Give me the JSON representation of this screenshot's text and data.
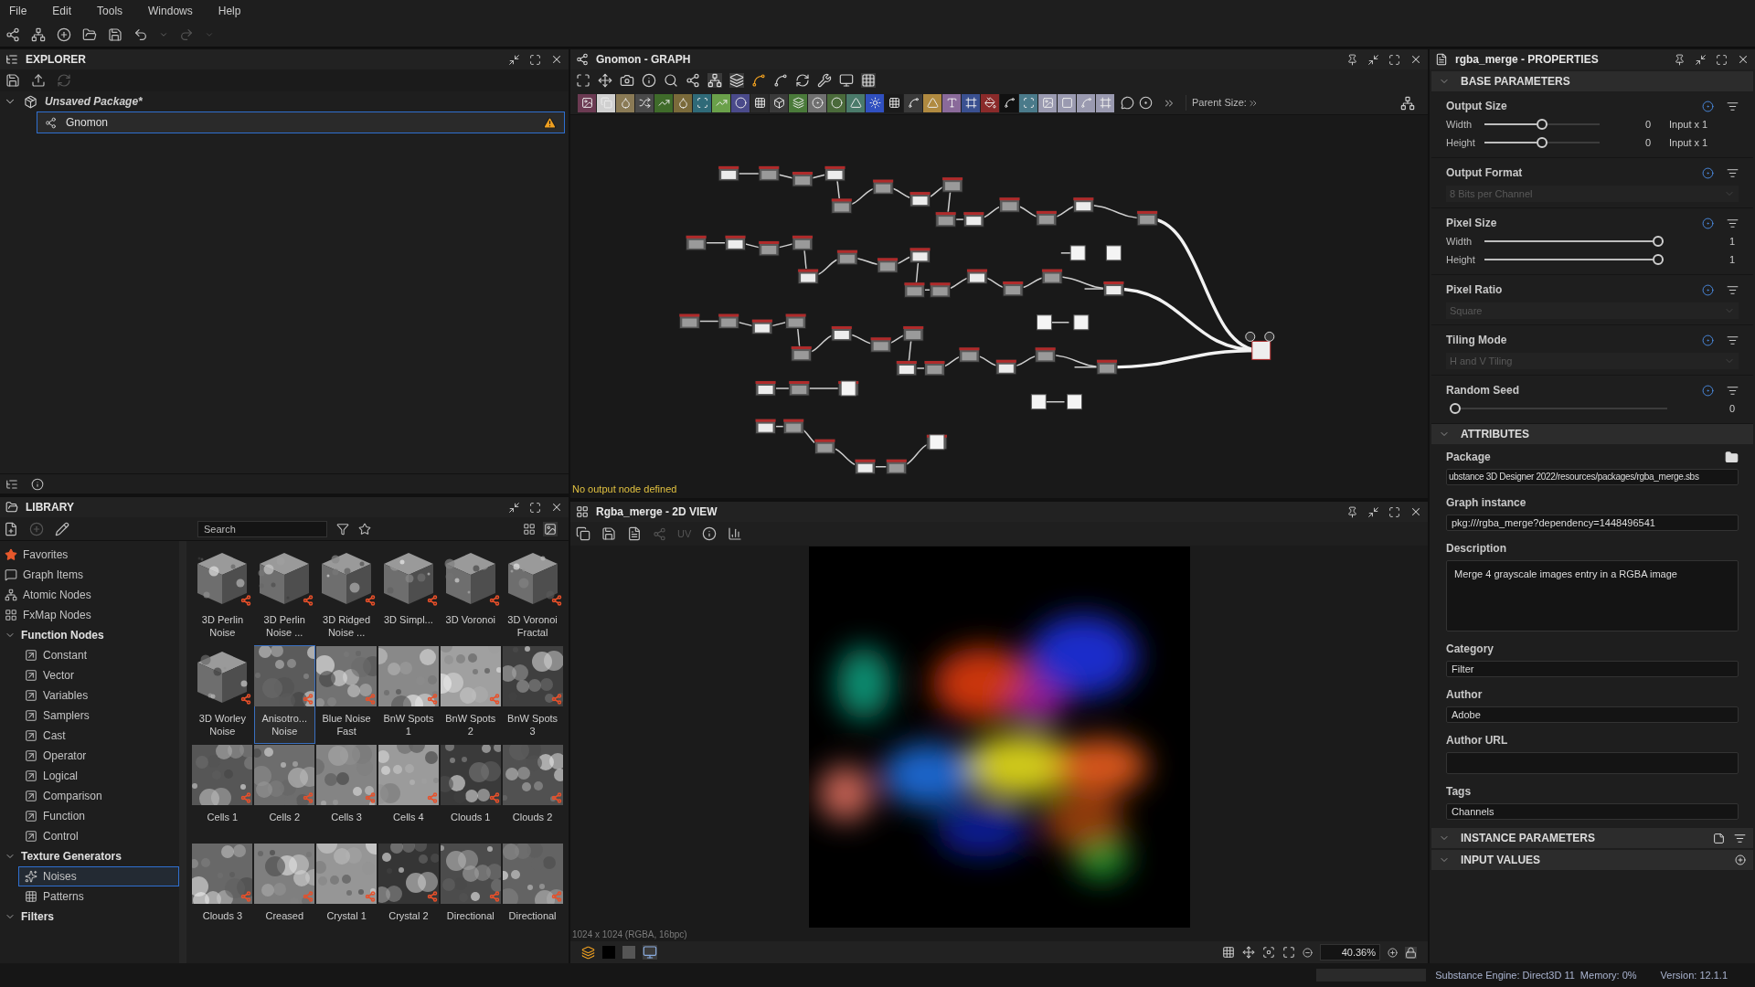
{
  "menu": [
    "File",
    "Edit",
    "Tools",
    "Windows",
    "Help"
  ],
  "explorer": {
    "title": "EXPLORER",
    "tree": [
      {
        "label": "Unsaved Package*",
        "expanded": true,
        "selected": false,
        "children": [
          {
            "label": "Gnomon",
            "selected": true,
            "warning": true
          }
        ]
      }
    ]
  },
  "library": {
    "title": "LIBRARY",
    "search": {
      "placeholder": "Search"
    },
    "categories": [
      {
        "label": "Favorites",
        "selected": false
      },
      {
        "label": "Graph Items",
        "selected": false
      },
      {
        "label": "Atomic Nodes",
        "selected": false
      },
      {
        "label": "FxMap Nodes",
        "selected": false
      },
      {
        "label": "Function Nodes",
        "selected": false,
        "expanded": true,
        "children": [
          {
            "label": "Constant",
            "selected": false
          },
          {
            "label": "Vector",
            "selected": false
          },
          {
            "label": "Variables",
            "selected": false
          },
          {
            "label": "Samplers",
            "selected": false
          },
          {
            "label": "Cast",
            "selected": false
          },
          {
            "label": "Operator",
            "selected": false
          },
          {
            "label": "Logical",
            "selected": false
          },
          {
            "label": "Comparison",
            "selected": false
          },
          {
            "label": "Function",
            "selected": false
          },
          {
            "label": "Control",
            "selected": false
          }
        ]
      },
      {
        "label": "Texture Generators",
        "selected": false,
        "expanded": true,
        "children": [
          {
            "label": "Noises",
            "selected": true
          },
          {
            "label": "Patterns",
            "selected": false
          }
        ]
      },
      {
        "label": "Filters",
        "selected": false,
        "expanded": true
      }
    ],
    "items": [
      {
        "label": "3D Perlin Noise",
        "kind": "cube",
        "selected": false
      },
      {
        "label": "3D Perlin Noise ...",
        "kind": "cube",
        "selected": false
      },
      {
        "label": "3D Ridged Noise ...",
        "kind": "cube",
        "selected": false
      },
      {
        "label": "3D Simpl...",
        "kind": "cube",
        "selected": false
      },
      {
        "label": "3D Voronoi",
        "kind": "cube",
        "selected": false
      },
      {
        "label": "3D Voronoi Fractal",
        "kind": "cube",
        "selected": false
      },
      {
        "label": "3D Worley Noise",
        "kind": "cube",
        "selected": false
      },
      {
        "label": "Anisotro... Noise",
        "kind": "texture",
        "selected": true
      },
      {
        "label": "Blue Noise Fast",
        "kind": "texture",
        "selected": false
      },
      {
        "label": "BnW Spots 1",
        "kind": "texture",
        "selected": false
      },
      {
        "label": "BnW Spots 2",
        "kind": "texture",
        "selected": false
      },
      {
        "label": "BnW Spots 3",
        "kind": "texture",
        "selected": false
      },
      {
        "label": "Cells 1",
        "kind": "texture",
        "selected": false
      },
      {
        "label": "Cells 2",
        "kind": "texture",
        "selected": false
      },
      {
        "label": "Cells 3",
        "kind": "texture",
        "selected": false
      },
      {
        "label": "Cells 4",
        "kind": "texture",
        "selected": false
      },
      {
        "label": "Clouds 1",
        "kind": "texture",
        "selected": false
      },
      {
        "label": "Clouds 2",
        "kind": "texture",
        "selected": false
      },
      {
        "label": "Clouds 3",
        "kind": "texture",
        "selected": false
      },
      {
        "label": "Creased",
        "kind": "texture",
        "selected": false
      },
      {
        "label": "Crystal 1",
        "kind": "texture",
        "selected": false
      },
      {
        "label": "Crystal 2",
        "kind": "texture",
        "selected": false
      },
      {
        "label": "Directional",
        "kind": "texture",
        "selected": false
      },
      {
        "label": "Directional",
        "kind": "texture",
        "selected": false
      }
    ]
  },
  "graph": {
    "title": "Gnomon - GRAPH",
    "parent_size": "Parent Size:",
    "status": "No output node defined"
  },
  "view": {
    "title": "Rgba_merge - 2D VIEW",
    "uv": "UV",
    "image_info": "1024 x 1024 (RGBA, 16bpc)",
    "zoom": "40.36%"
  },
  "properties": {
    "title": "rgba_merge - PROPERTIES",
    "base_parameters": {
      "title": "BASE PARAMETERS",
      "expanded": true,
      "groups": [
        {
          "label": "Output Size",
          "kind": "sliders",
          "rows": [
            {
              "label": "Width",
              "level": 0.5,
              "value": "0",
              "mode": "Input x 1"
            },
            {
              "label": "Height",
              "level": 0.5,
              "value": "0",
              "mode": "Input x 1"
            }
          ]
        },
        {
          "label": "Output Format",
          "kind": "dropdown",
          "value": "8 Bits per Channel",
          "disabled": true
        },
        {
          "label": "Pixel Size",
          "kind": "sliders",
          "rows": [
            {
              "label": "Width",
              "level": 1,
              "value": "1"
            },
            {
              "label": "Height",
              "level": 1,
              "value": "1"
            }
          ]
        },
        {
          "label": "Pixel Ratio",
          "kind": "dropdown",
          "value": "Square",
          "disabled": true
        },
        {
          "label": "Tiling Mode",
          "kind": "dropdown",
          "value": "H and V Tiling",
          "disabled": true
        },
        {
          "label": "Random Seed",
          "kind": "sliders",
          "rows": [
            {
              "level": 0,
              "value": "0"
            }
          ]
        }
      ]
    },
    "attributes": {
      "title": "ATTRIBUTES",
      "expanded": true,
      "fields": [
        {
          "label": "Package",
          "kind": "path",
          "value": "ubstance 3D Designer 2022/resources/packages/rgba_merge.sbs"
        },
        {
          "label": "Graph instance",
          "kind": "line",
          "value": "pkg:///rgba_merge?dependency=1448496541"
        },
        {
          "label": "Description",
          "kind": "multiline",
          "value": "Merge 4 grayscale images entry in a RGBA image"
        },
        {
          "label": "Category",
          "kind": "line",
          "value": "Filter"
        },
        {
          "label": "Author",
          "kind": "line",
          "value": "Adobe"
        },
        {
          "label": "Author URL",
          "kind": "line"
        },
        {
          "label": "Tags",
          "kind": "line",
          "value": "Channels"
        }
      ]
    },
    "instance_parameters": {
      "title": "INSTANCE PARAMETERS"
    },
    "input_values": {
      "title": "INPUT VALUES"
    }
  },
  "status_bar": {
    "engine": "Substance Engine: Direct3D 11",
    "memory": "Memory: 0%",
    "version": "Version: 12.1.1"
  }
}
